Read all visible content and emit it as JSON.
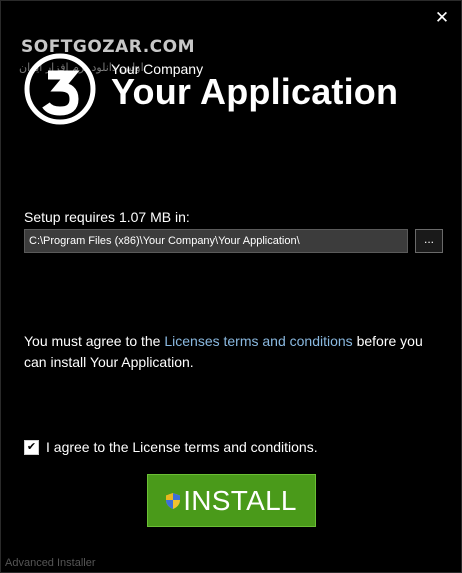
{
  "window": {
    "close_glyph": "✕"
  },
  "watermark": {
    "text": "SOFTGOZAR.COM",
    "subtext": "اولین دانلود نرم افزار ایران"
  },
  "header": {
    "company": "Your Company",
    "app_title": "Your Application",
    "logo_icon": "advanced-installer-logo"
  },
  "setup": {
    "requires_label": "Setup requires 1.07 MB in:",
    "install_path": "C:\\Program Files (x86)\\Your Company\\Your Application\\",
    "browse_label": "..."
  },
  "license": {
    "text_before": "You must agree to the ",
    "link_text": "Licenses terms and conditions",
    "text_after": " before you can install Your Application."
  },
  "agree": {
    "checked": true,
    "check_glyph": "✔",
    "label": "I agree to the License terms and conditions."
  },
  "install_button": {
    "label": "INSTALL",
    "icon": "uac-shield-icon"
  },
  "footer": {
    "text": "Advanced Installer"
  },
  "colors": {
    "background": "#000000",
    "install_green": "#4a9a1a",
    "link_blue": "#8ab9e0",
    "path_field_bg": "#3c3c3c"
  }
}
